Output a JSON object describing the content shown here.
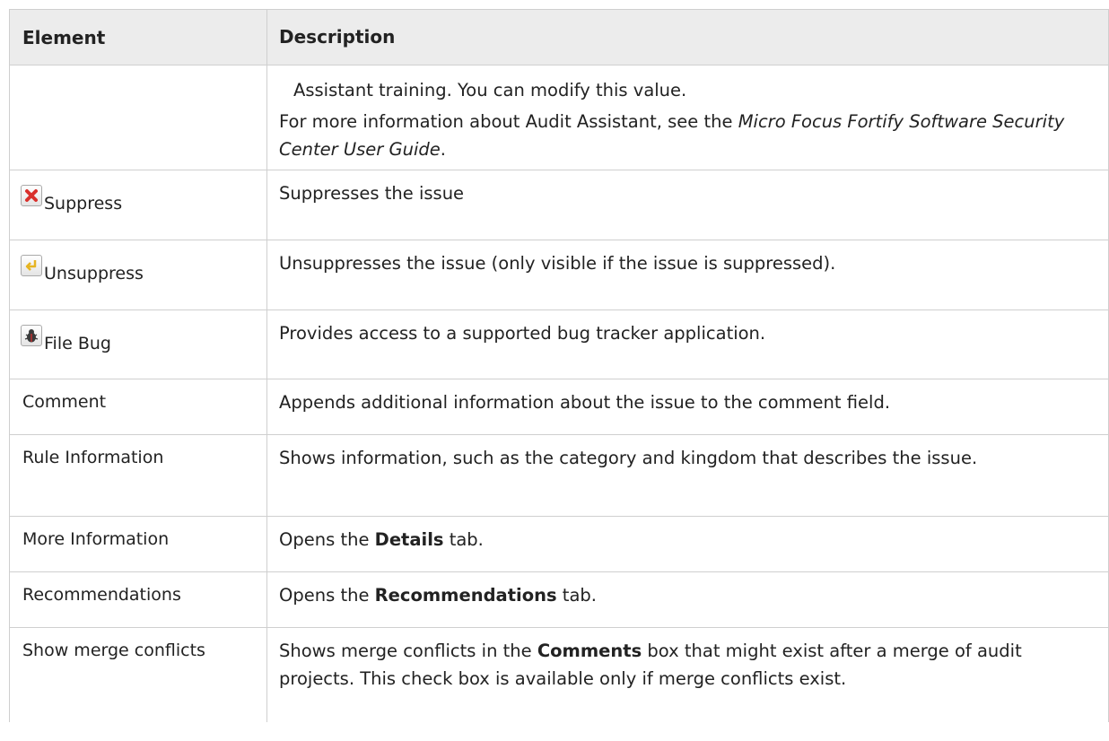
{
  "table": {
    "header": {
      "element": "Element",
      "description": "Description"
    },
    "cont": {
      "line1": "Assistant training. You can modify this value.",
      "line2_pre": "For more information about Audit Assistant, see the ",
      "line2_italic": "Micro Focus Fortify Software Security Center User Guide",
      "line2_post": "."
    },
    "rows": [
      {
        "element": "Suppress",
        "icon": "suppress-icon",
        "desc": "Suppresses the issue"
      },
      {
        "element": "Unsuppress",
        "icon": "unsuppress-icon",
        "desc": "Unsuppresses the issue (only visible if the issue is suppressed)."
      },
      {
        "element": "File Bug",
        "icon": "bug-icon",
        "desc": "Provides access to a supported bug tracker application."
      },
      {
        "element": "Comment",
        "desc": "Appends additional information about the issue to the comment field."
      },
      {
        "element": "Rule Information",
        "desc": "Shows information, such as the category and kingdom that describes the issue."
      },
      {
        "element": "More Information",
        "desc_pre": "Opens the ",
        "desc_bold": "Details",
        "desc_post": " tab."
      },
      {
        "element": "Recommendations",
        "desc_pre": "Opens the ",
        "desc_bold": "Recommendations",
        "desc_post": " tab."
      },
      {
        "element": "Show merge conflicts",
        "desc_pre": "Shows merge conflicts in the ",
        "desc_bold": "Comments",
        "desc_post": " box that might exist after a merge of audit projects. This check box is available only if merge conflicts exist."
      }
    ]
  },
  "colors": {
    "header_bg": "#ececec",
    "border": "#cfcfcf",
    "suppress_red": "#d9302c",
    "unsuppress_yellow": "#e6b422"
  }
}
